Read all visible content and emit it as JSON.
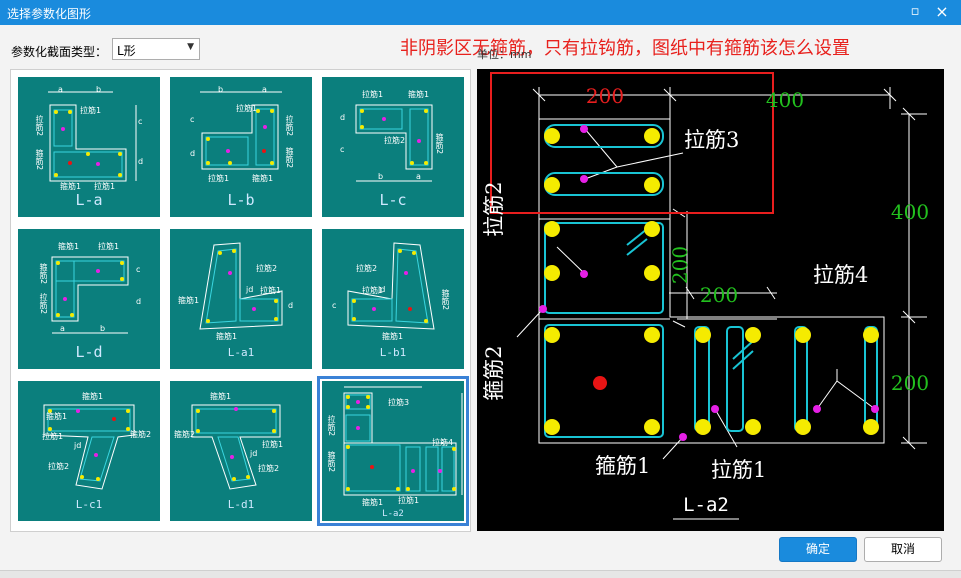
{
  "window": {
    "title": "选择参数化图形",
    "maximize_icon": "▫",
    "close_icon": "×"
  },
  "toolbar": {
    "type_label": "参数化截面类型：",
    "type_value": "L形",
    "dropdown_icon": "▼"
  },
  "notice": "非阴影区无箍筋，只有拉钩筋，图纸中有箍筋该怎么设置",
  "unit_label": "单位：mm",
  "thumbnails": [
    {
      "caption": "L-a",
      "labels": [
        "a",
        "b",
        "c",
        "d",
        "拉筋1",
        "拉筋2",
        "箍筋2",
        "箍筋1",
        "拉筋1"
      ]
    },
    {
      "caption": "L-b",
      "labels": [
        "b",
        "a",
        "c",
        "d",
        "拉筋1",
        "拉筋2",
        "箍筋2",
        "拉筋1",
        "箍筋1"
      ]
    },
    {
      "caption": "L-c",
      "labels": [
        "拉筋1",
        "箍筋1",
        "d",
        "c",
        "拉筋2",
        "箍筋2",
        "b",
        "a"
      ]
    },
    {
      "caption": "L-d",
      "labels": [
        "箍筋1",
        "拉筋1",
        "箍筋2",
        "拉筋2",
        "a",
        "b",
        "c",
        "d"
      ]
    },
    {
      "caption": "L-a1",
      "labels": [
        "拉筋2",
        "拉筋1",
        "箍筋1",
        "jd",
        "箍筋1",
        "d"
      ]
    },
    {
      "caption": "L-b1",
      "labels": [
        "拉筋2",
        "拉筋1",
        "jd",
        "箍筋1",
        "箍筋2",
        "c"
      ]
    },
    {
      "caption": "L-c1",
      "labels": [
        "箍筋1",
        "拉筋1",
        "jd",
        "箍筋2",
        "拉筋2",
        "箍筋1"
      ]
    },
    {
      "caption": "L-d1",
      "labels": [
        "箍筋1",
        "拉筋1",
        "jd",
        "拉筋2",
        "箍筋2"
      ]
    },
    {
      "caption": "L-a2",
      "labels": [
        "拉筋3",
        "拉筋2",
        "箍筋2",
        "拉筋4",
        "箍筋1",
        "拉筋1"
      ]
    }
  ],
  "preview": {
    "dims": [
      "200",
      "400",
      "400",
      "200",
      "200",
      "200"
    ],
    "labels": [
      "拉筋3",
      "拉筋2",
      "拉筋4",
      "箍筋2",
      "箍筋1",
      "拉筋1"
    ],
    "caption": "L-a2",
    "colors": {
      "dim_green": "#22c01e",
      "dim_red": "#e81e1e",
      "highlight_box": "#e81e1e",
      "stirrup": "#19c4d4",
      "bar": "#f5eb00",
      "tie_point": "#e620e6",
      "center_point": "#e81414"
    }
  },
  "buttons": {
    "ok": "确定",
    "cancel": "取消"
  }
}
